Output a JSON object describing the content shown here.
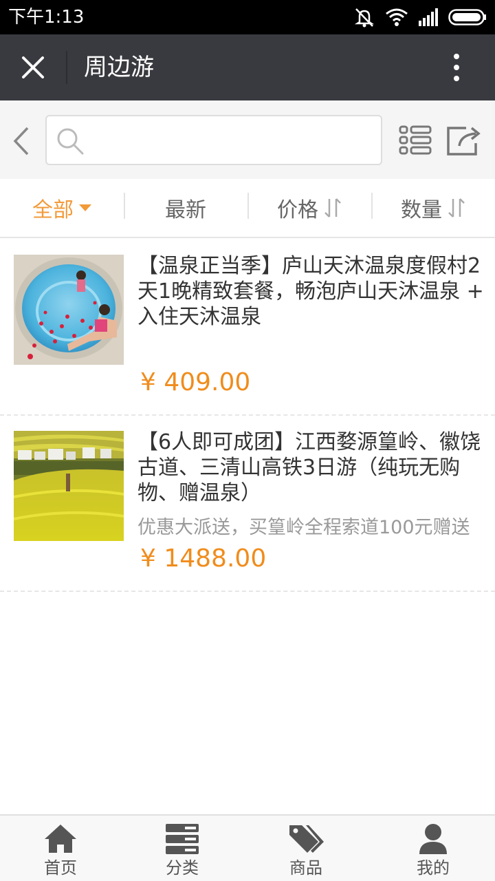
{
  "status_bar": {
    "time": "下午1:13",
    "icons": [
      "mute-icon",
      "wifi-icon",
      "signal-icon",
      "battery-icon"
    ]
  },
  "header": {
    "title": "周边游",
    "close_icon": "close-icon",
    "more_icon": "more-vertical-icon"
  },
  "search": {
    "value": "",
    "placeholder": ""
  },
  "filters": [
    {
      "label": "全部",
      "active": true,
      "indicator": "dropdown"
    },
    {
      "label": "最新",
      "active": false,
      "indicator": "none"
    },
    {
      "label": "价格",
      "active": false,
      "indicator": "sort"
    },
    {
      "label": "数量",
      "active": false,
      "indicator": "sort"
    }
  ],
  "products": [
    {
      "title": "【温泉正当季】庐山天沐温泉度假村2天1晚精致套餐，畅泡庐山天沐温泉 + 入住天沐温泉",
      "promo": "",
      "price": "¥ 409.00",
      "image": "hot-spring-pool-photo"
    },
    {
      "title": "【6人即可成团】江西婺源篁岭、徽饶古道、三清山高铁3日游（纯玩无购物、赠温泉）",
      "promo": "优惠大派送，买篁岭全程索道100元赠送",
      "price": "¥ 1488.00",
      "image": "rapeseed-field-village-photo"
    }
  ],
  "bottom_nav": [
    {
      "label": "首页",
      "icon": "home-icon"
    },
    {
      "label": "分类",
      "icon": "category-icon"
    },
    {
      "label": "商品",
      "icon": "tag-icon"
    },
    {
      "label": "我的",
      "icon": "user-icon"
    }
  ],
  "colors": {
    "accent": "#f29a38",
    "price": "#f08c1c",
    "header_bg": "#393a3f"
  }
}
